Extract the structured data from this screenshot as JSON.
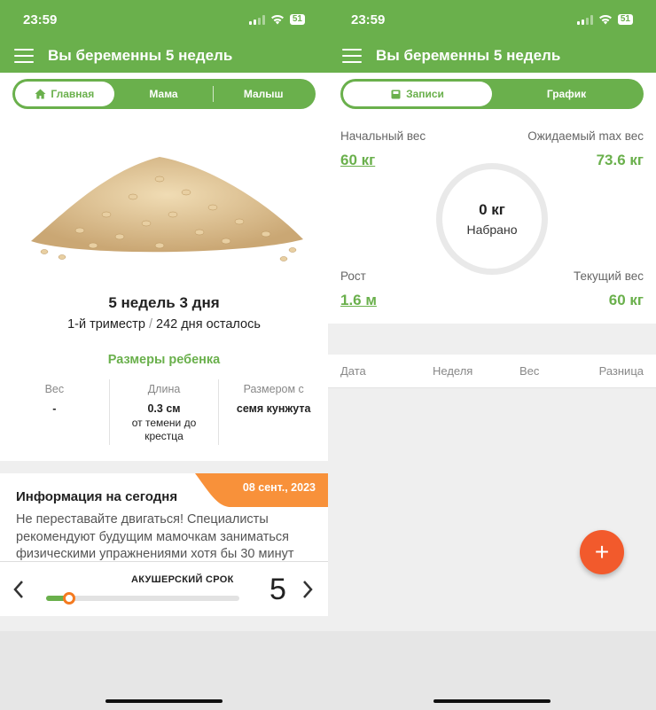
{
  "status": {
    "time": "23:59",
    "battery": "51"
  },
  "left": {
    "header_title": "Вы беременны 5 недель",
    "tabs": [
      {
        "label": "Главная",
        "icon": "home-icon"
      },
      {
        "label": "Мама"
      },
      {
        "label": "Малыш"
      }
    ],
    "baby": {
      "title": "5 недель 3 дня",
      "trimester": "1-й триместр",
      "separator": "/",
      "days_left": "242 дня осталось",
      "sizes_title": "Размеры ребенка",
      "sizes": [
        {
          "label": "Вес",
          "value": "-",
          "note": ""
        },
        {
          "label": "Длина",
          "value": "0.3 см",
          "note": "от темени до крестца"
        },
        {
          "label": "Размером с",
          "value": "семя кунжута",
          "note": ""
        }
      ]
    },
    "info": {
      "date": "08 сент., 2023",
      "title": "Информация на сегодня",
      "text": "Не переставайте двигаться! Специалисты рекомендуют будущим мамочкам заниматься физическими упражнениями хотя бы 30 минут"
    },
    "term": {
      "label": "АКУШЕРСКИЙ СРОК",
      "week": "5",
      "progress": 0.12
    }
  },
  "right": {
    "header_title": "Вы беременны 5 недель",
    "tabs": [
      {
        "label": "Записи",
        "icon": "journal-icon"
      },
      {
        "label": "График"
      }
    ],
    "weight": {
      "start_label": "Начальный вес",
      "start_value": "60 кг",
      "max_label": "Ожидаемый max вес",
      "max_value": "73.6 кг",
      "gained_value": "0 кг",
      "gained_label": "Набрано",
      "height_label": "Рост",
      "height_value": "1.6 м",
      "current_label": "Текущий вес",
      "current_value": "60 кг"
    },
    "table_headers": [
      "Дата",
      "Неделя",
      "Вес",
      "Разница"
    ],
    "fab_label": "+"
  },
  "colors": {
    "brand": "#6ab04c",
    "accent": "#f47a20",
    "fab": "#f25a2c"
  }
}
